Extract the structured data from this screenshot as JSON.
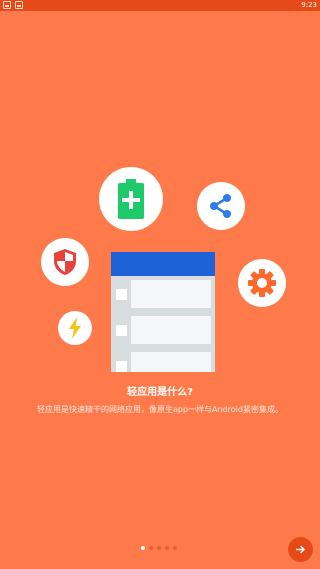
{
  "status_bar": {
    "time": "9:23",
    "notification_icons": [
      "app-notification-icon",
      "app-notification-icon"
    ]
  },
  "illustration": {
    "icons": [
      "battery-plus-icon",
      "share-icon",
      "shield-icon",
      "gear-icon",
      "lightning-icon"
    ],
    "colors": {
      "background": "#FF7A4B",
      "battery": "#1ECB6B",
      "share": "#2F7BE8",
      "shield": "#E9413B",
      "gear": "#FF6A2C",
      "lightning": "#F6C21C",
      "mock_header": "#1E62D8"
    }
  },
  "intro": {
    "title": "轻应用是什么?",
    "description": "轻应用是快速精干的网络应用，像原生app一样与Android紧密集成。"
  },
  "pagination": {
    "total": 5,
    "current": 1
  },
  "next_button": {
    "icon": "arrow-right-icon"
  }
}
